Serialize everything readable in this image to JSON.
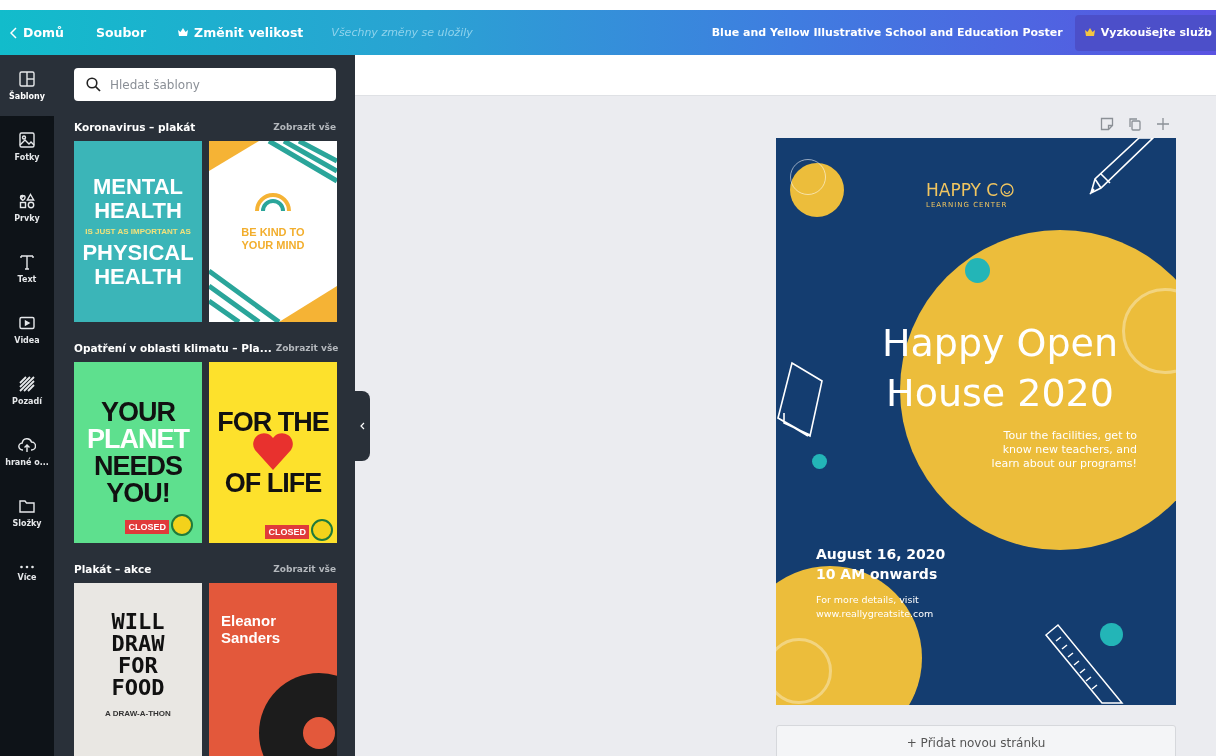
{
  "top_bar": {
    "back": "Domů",
    "file": "Soubor",
    "resize": "Změnit velikost",
    "save_status": "Všechny změny se uložily",
    "document_title": "Blue and Yellow Illustrative School and Education Poster",
    "trial_button": "Vyzkoušejte služb"
  },
  "rail": [
    {
      "kind": "templates",
      "label": "Šablony",
      "selected": true
    },
    {
      "kind": "photos",
      "label": "Fotky",
      "selected": false
    },
    {
      "kind": "elements",
      "label": "Prvky",
      "selected": false
    },
    {
      "kind": "text",
      "label": "Text",
      "selected": false
    },
    {
      "kind": "videos",
      "label": "Videa",
      "selected": false
    },
    {
      "kind": "background",
      "label": "Pozadí",
      "selected": false
    },
    {
      "kind": "uploads",
      "label": "hrané o...",
      "selected": false
    },
    {
      "kind": "folders",
      "label": "Složky",
      "selected": false
    },
    {
      "kind": "more",
      "label": "Více",
      "selected": false
    }
  ],
  "panel": {
    "search": {
      "placeholder": "Hledat šablony"
    },
    "sections": [
      {
        "title": "Koronavirus – plakát",
        "see_all": "Zobrazit vše",
        "templates": [
          {
            "kind": "teal",
            "lines": [
              {
                "text": "MENTAL",
                "accent": false
              },
              {
                "text": "HEALTH",
                "accent": false
              },
              {
                "text": "IS JUST AS IMPORTANT AS",
                "accent": true
              },
              {
                "text": "PHYSICAL",
                "accent": false
              },
              {
                "text": "HEALTH",
                "accent": false
              }
            ]
          },
          {
            "kind": "rainbow",
            "lines": [
              {
                "text": "BE KIND TO",
                "accent": false
              },
              {
                "text": "YOUR MIND",
                "accent": false
              }
            ]
          }
        ]
      },
      {
        "title": "Opatření v oblasti klimatu – Pla...",
        "see_all": "Zobrazit vše",
        "templates": [
          {
            "kind": "green",
            "lines": [
              {
                "text": "YOUR",
                "accent": false
              },
              {
                "text": "PLANET",
                "accent": true
              },
              {
                "text": "NEEDS",
                "accent": false
              },
              {
                "text": "YOU!",
                "accent": false
              }
            ],
            "sticker": "CLOSED"
          },
          {
            "kind": "yellow",
            "lines": [
              {
                "text": "FOR THE",
                "accent": false
              },
              {
                "text": "OF LIFE",
                "accent": false
              }
            ],
            "sticker": "CLOSED"
          }
        ]
      },
      {
        "title": "Plakát – akce",
        "see_all": "Zobrazit vše",
        "templates": [
          {
            "kind": "sketch",
            "lines": [
              {
                "text": "WILL",
                "accent": false
              },
              {
                "text": "DRAW",
                "accent": false
              },
              {
                "text": "FOR",
                "accent": false
              },
              {
                "text": "FOOD",
                "accent": false
              }
            ],
            "subtitle": "A DRAW-A-THON"
          },
          {
            "kind": "record",
            "lines": [
              {
                "text": "Eleanor",
                "accent": false
              },
              {
                "text": "Sanders",
                "accent": false
              }
            ]
          }
        ]
      }
    ]
  },
  "poster": {
    "brand": "HAPPY C",
    "brand_sub": "LEARNING CENTER",
    "headline": [
      "Happy Open",
      "House 2020"
    ],
    "tagline": [
      "Tour the facilities, get to",
      "know new teachers, and",
      "learn about our programs!"
    ],
    "date": [
      "August 16, 2020",
      "10 AM onwards"
    ],
    "details": [
      "For more details, visit",
      "www.reallygreatsite.com"
    ]
  },
  "add_page": "+ Přidat novou stránku"
}
